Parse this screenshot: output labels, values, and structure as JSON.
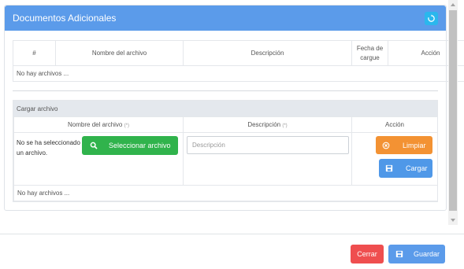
{
  "panel": {
    "title": "Documentos Adicionales",
    "refresh_icon": "refresh-icon"
  },
  "files_table": {
    "headers": [
      "#",
      "Nombre del archivo",
      "Descripción",
      "Fecha de cargue",
      "Acción"
    ],
    "header_fecha_line1": "Fecha de",
    "header_fecha_line2": "cargue",
    "empty_text": "No hay archivos ..."
  },
  "upload": {
    "section_title": "Cargar archivo",
    "headers": {
      "file_name": "Nombre del archivo",
      "description": "Descripción",
      "action": "Acción",
      "required_mark": "(*)"
    },
    "no_file_text": "No se ha seleccionado un archivo.",
    "select_button": "Seleccionar archivo",
    "description_placeholder": "Descripción",
    "description_value": "",
    "clear_button": "Limpiar",
    "upload_button": "Cargar",
    "empty_text": "No hay archivos ..."
  },
  "footer": {
    "close_button": "Cerrar",
    "save_button": "Guardar"
  },
  "colors": {
    "header_blue": "#5b9bea",
    "refresh_cyan": "#2ab7ed",
    "select_green": "#30b34c",
    "clear_orange": "#f39233",
    "upload_blue": "#4f98e8",
    "close_red": "#ef4e4f",
    "save_blue": "#5b9bea"
  }
}
